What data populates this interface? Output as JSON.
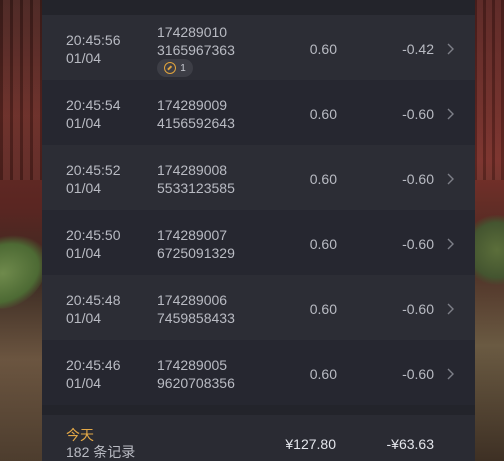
{
  "records": [
    {
      "time": "20:45:56",
      "date": "01/04",
      "id_line1": "174289010",
      "id_line2": "3165967363",
      "amount": "0.60",
      "profit": "-0.42",
      "badge": "1",
      "badge_icon": "orange-refresh-icon"
    },
    {
      "time": "20:45:54",
      "date": "01/04",
      "id_line1": "174289009",
      "id_line2": "4156592643",
      "amount": "0.60",
      "profit": "-0.60"
    },
    {
      "time": "20:45:52",
      "date": "01/04",
      "id_line1": "174289008",
      "id_line2": "5533123585",
      "amount": "0.60",
      "profit": "-0.60"
    },
    {
      "time": "20:45:50",
      "date": "01/04",
      "id_line1": "174289007",
      "id_line2": "6725091329",
      "amount": "0.60",
      "profit": "-0.60"
    },
    {
      "time": "20:45:48",
      "date": "01/04",
      "id_line1": "174289006",
      "id_line2": "7459858433",
      "amount": "0.60",
      "profit": "-0.60"
    },
    {
      "time": "20:45:46",
      "date": "01/04",
      "id_line1": "174289005",
      "id_line2": "9620708356",
      "amount": "0.60",
      "profit": "-0.60"
    }
  ],
  "footer": {
    "today_label": "今天",
    "count_label": "182 条记录",
    "total_amount": "¥127.80",
    "total_profit": "-¥63.63"
  },
  "colors": {
    "panel_bg": "#23242b",
    "accent_today": "#e3a847",
    "text": "#b9bbc3"
  },
  "icons": {
    "row_action": "chevron-right-icon"
  }
}
